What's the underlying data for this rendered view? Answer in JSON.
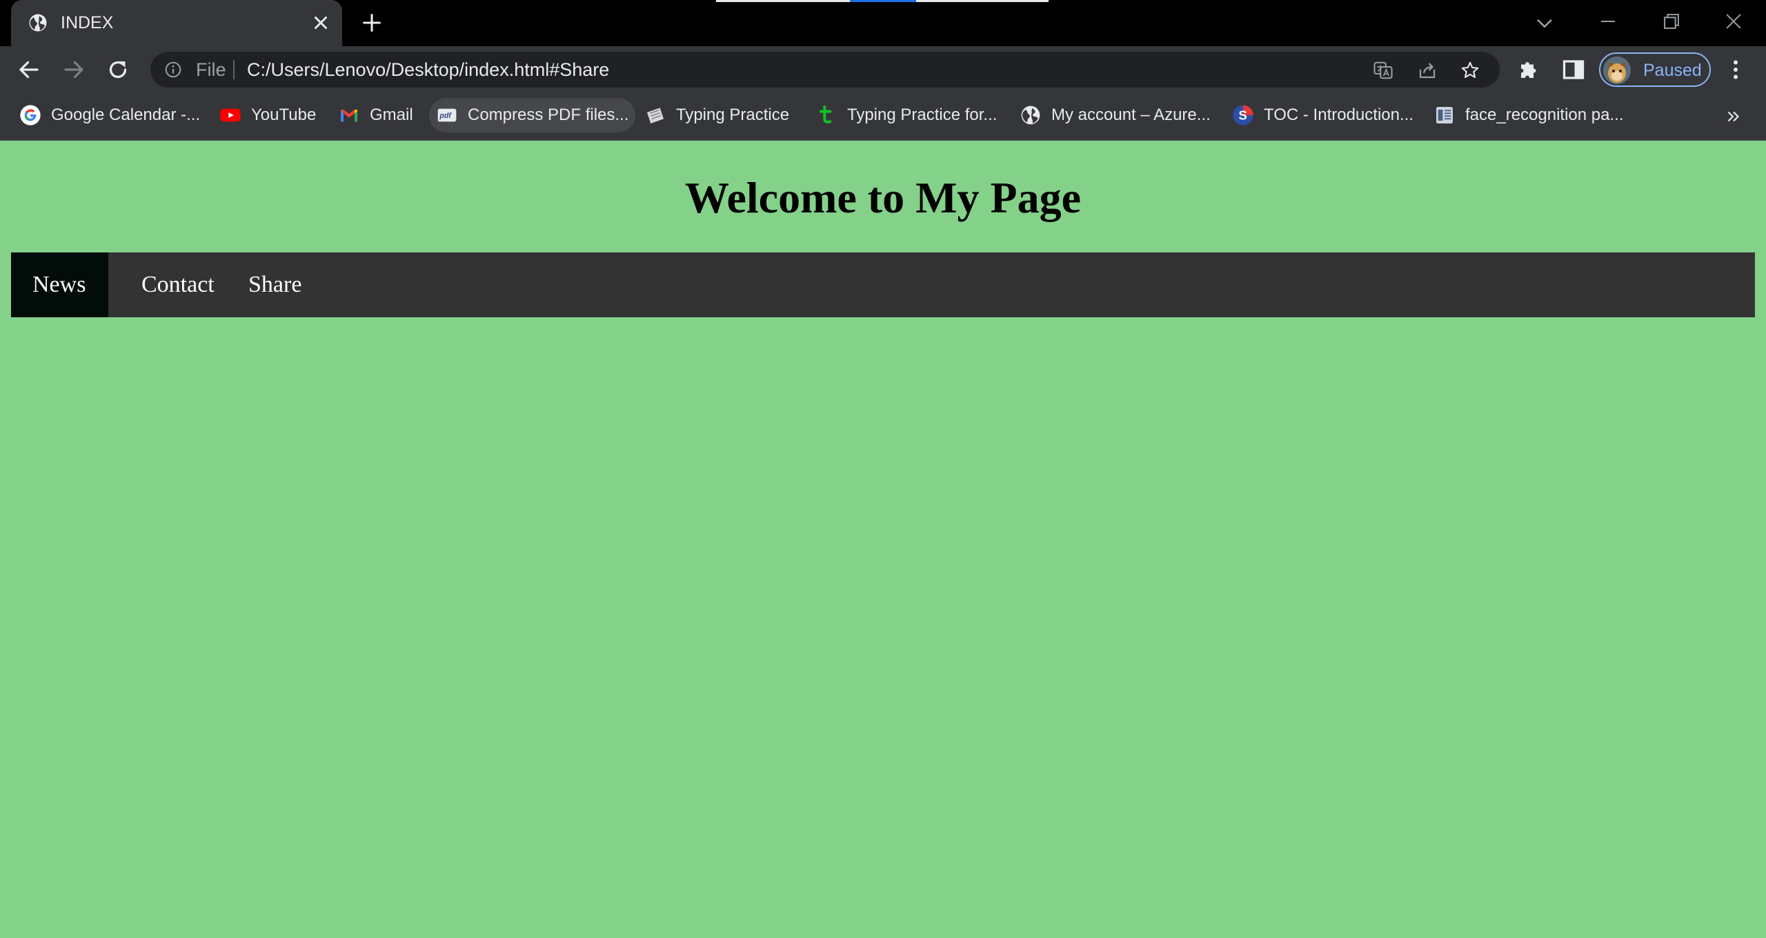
{
  "browser": {
    "tab": {
      "title": "INDEX",
      "favicon": "globe-icon"
    },
    "address_bar": {
      "scheme": "File",
      "url": "C:/Users/Lenovo/Desktop/index.html#Share"
    },
    "profile": {
      "label": "Paused"
    },
    "colors": {
      "tabstrip": "#000000",
      "toolbar": "#35363a",
      "omnibox": "#202124",
      "accent": "#8ab4f8"
    }
  },
  "bookmarks": [
    {
      "label": "Google Calendar -...",
      "icon": "google-icon"
    },
    {
      "label": "YouTube",
      "icon": "youtube-icon"
    },
    {
      "label": "Gmail",
      "icon": "gmail-icon"
    },
    {
      "label": "Compress PDF files...",
      "icon": "pdf-icon"
    },
    {
      "label": "Typing Practice",
      "icon": "keyboard-icon"
    },
    {
      "label": "Typing Practice for...",
      "icon": "typing-t-icon"
    },
    {
      "label": "My account – Azure...",
      "icon": "globe-icon"
    },
    {
      "label": "TOC - Introduction...",
      "icon": "site-s-icon"
    },
    {
      "label": "face_recognition pa...",
      "icon": "document-icon"
    }
  ],
  "page": {
    "heading": "Welcome to My Page",
    "nav": [
      {
        "label": "News",
        "active": true
      },
      {
        "label": "Contact",
        "active": false
      },
      {
        "label": "Share",
        "active": false
      }
    ],
    "colors": {
      "background": "#84d18a",
      "navbar": "#333333",
      "active_item": "#020c08",
      "nav_text": "#ffffff"
    }
  }
}
